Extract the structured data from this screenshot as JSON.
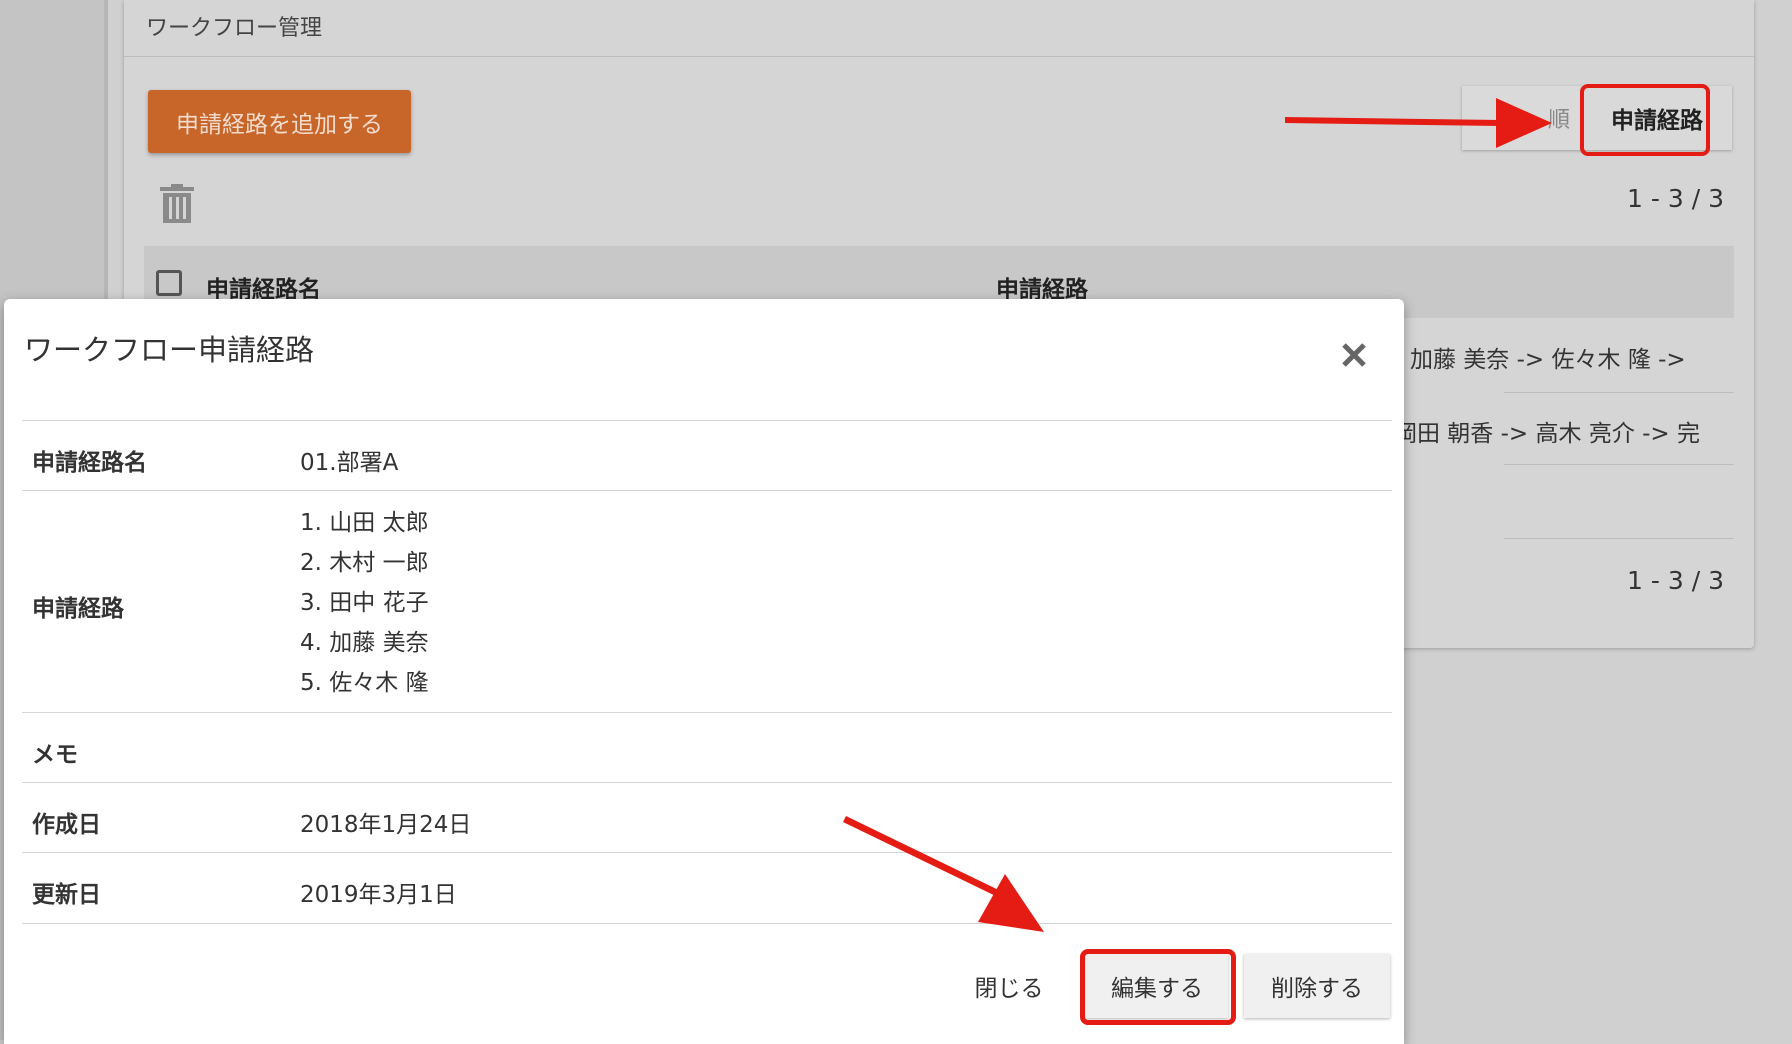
{
  "background": {
    "panel_title": "ワークフロー管理",
    "add_button_label": "申請経路を追加する",
    "tab_hidden_label": "順",
    "tab_route_label": "申請経路",
    "pagination_top": "1 - 3 / 3",
    "pagination_bottom": "1 - 3 / 3",
    "table": {
      "columns": [
        "申請経路名",
        "申請経路"
      ],
      "rows": [
        "加藤 美奈 -> 佐々木 隆 ->",
        "岡田 朝香 -> 高木 亮介 -> 完"
      ]
    }
  },
  "modal": {
    "title": "ワークフロー申請経路",
    "fields": {
      "name_label": "申請経路名",
      "name_value": "01.部署A",
      "route_label": "申請経路",
      "route_steps": [
        "1. 山田 太郎",
        "2. 木村 一郎",
        "3. 田中 花子",
        "4. 加藤 美奈",
        "5. 佐々木 隆"
      ],
      "memo_label": "メモ",
      "memo_value": "",
      "created_label": "作成日",
      "created_value": "2018年1月24日",
      "updated_label": "更新日",
      "updated_value": "2019年3月1日"
    },
    "buttons": {
      "close": "閉じる",
      "edit": "編集する",
      "delete": "削除する"
    }
  },
  "colors": {
    "accent": "#c8662a",
    "highlight": "#e51c14",
    "overlay": "#d0d0d0"
  },
  "icons": [
    "trash-icon",
    "close-icon",
    "checkbox-icon"
  ]
}
